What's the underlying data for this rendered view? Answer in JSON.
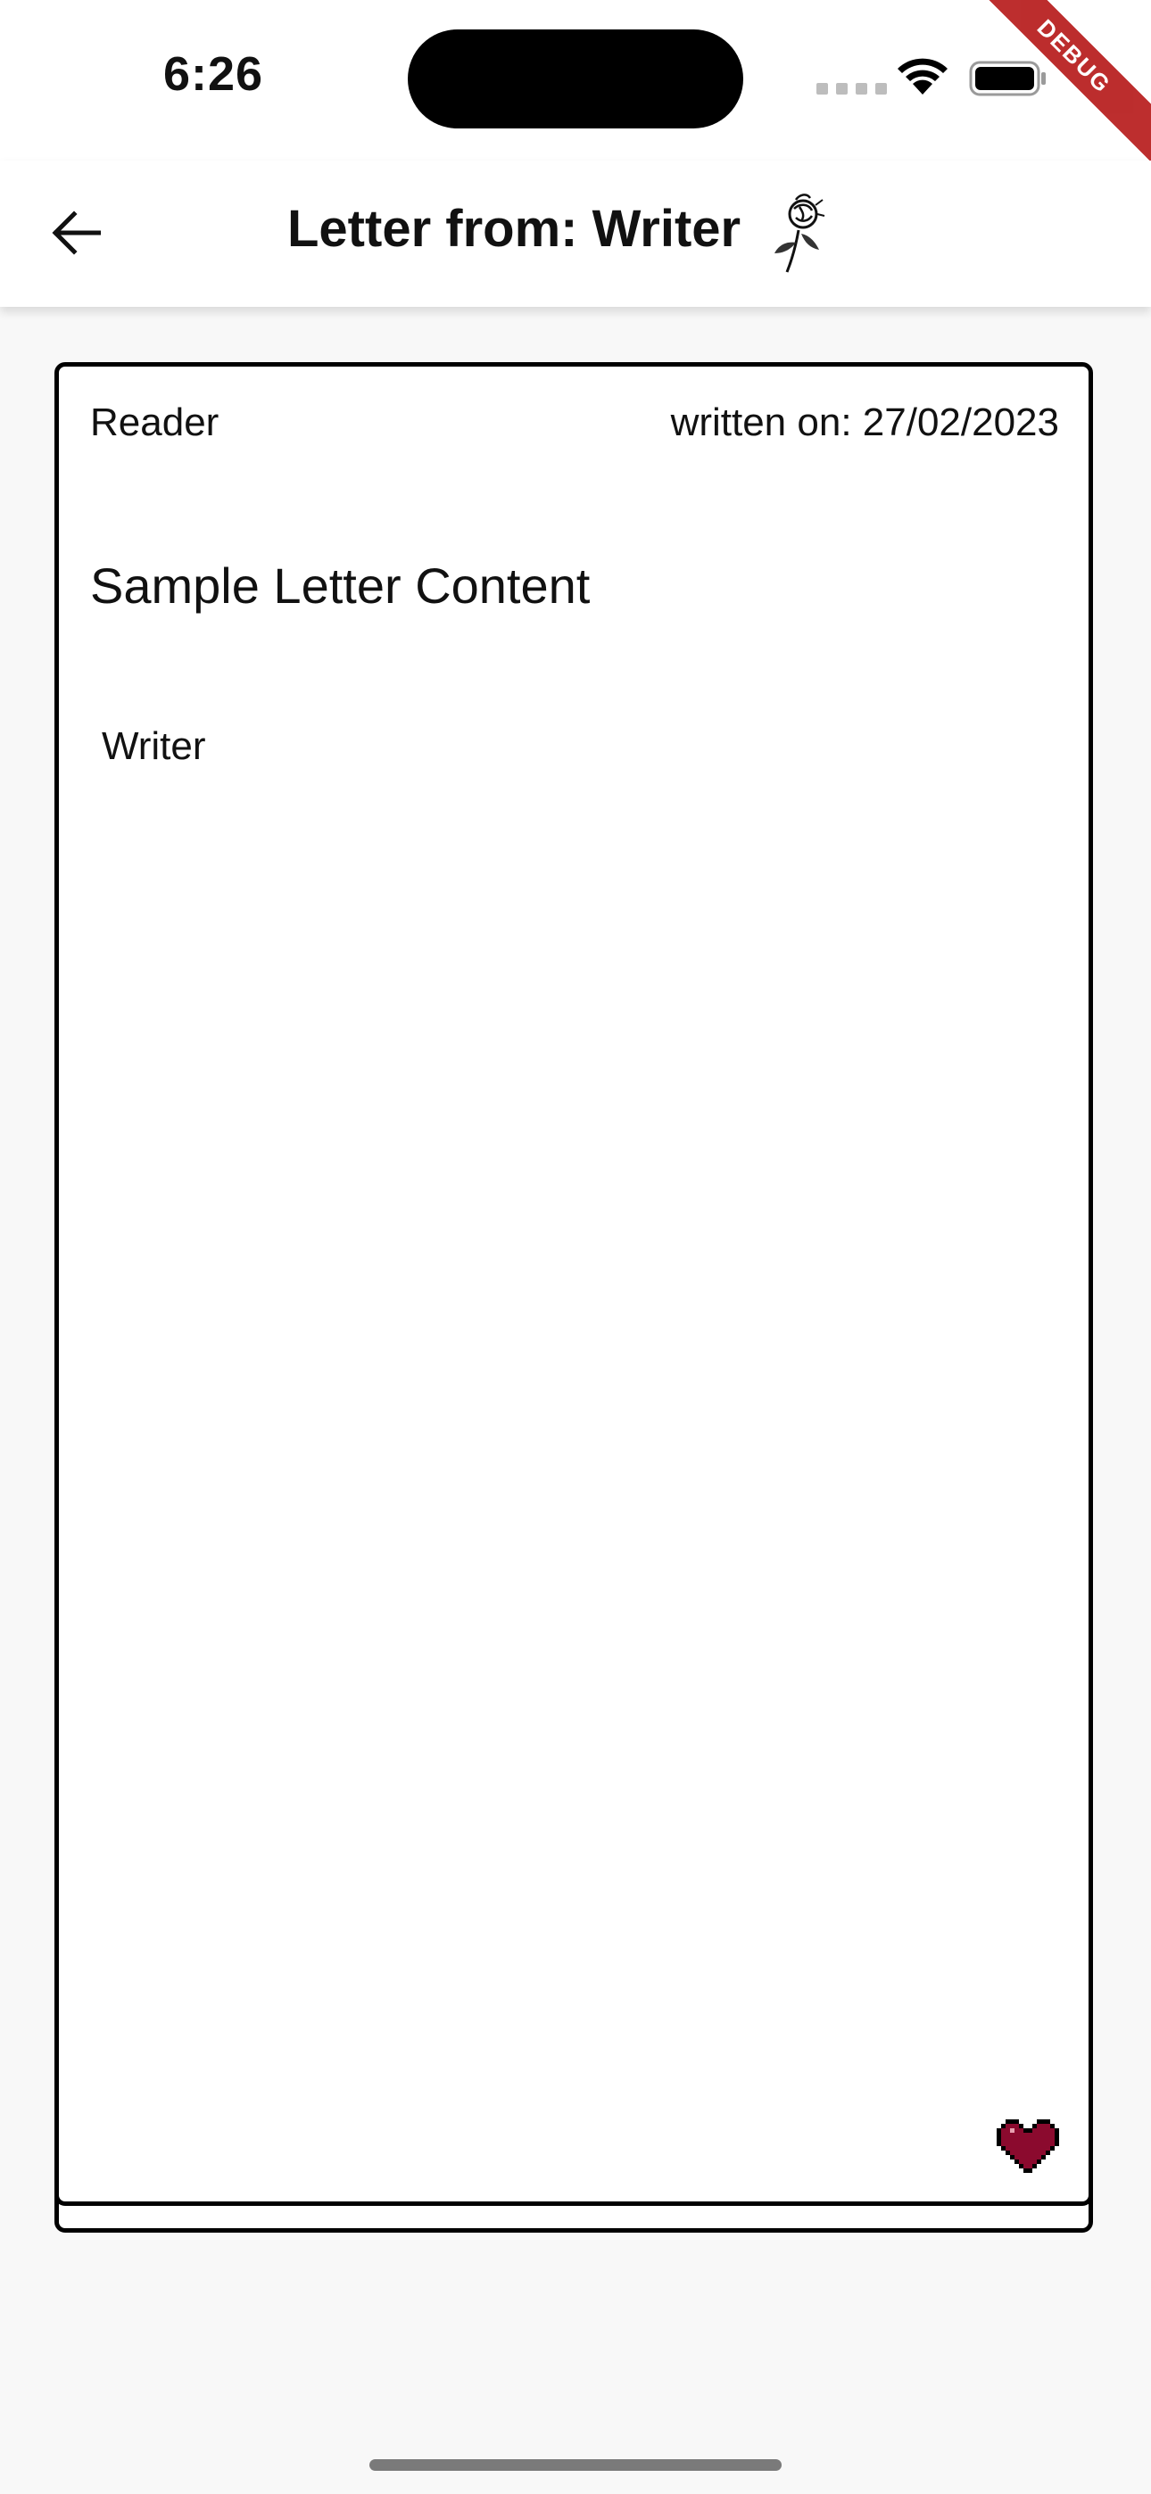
{
  "status_bar": {
    "time": "6:26",
    "icons": [
      "signal-icon",
      "wifi-icon",
      "battery-icon"
    ]
  },
  "debug_banner": "DEBUG",
  "app_bar": {
    "back_icon": "arrow-left-icon",
    "title": "Letter from: Writer",
    "decoration_icon": "rose-icon"
  },
  "letter": {
    "recipient": "Reader",
    "date_text": "written on: 27/02/2023",
    "content": "Sample Letter Content",
    "signature": "Writer",
    "like_icon": "heart-icon",
    "like_color": "#8b0a2e"
  }
}
